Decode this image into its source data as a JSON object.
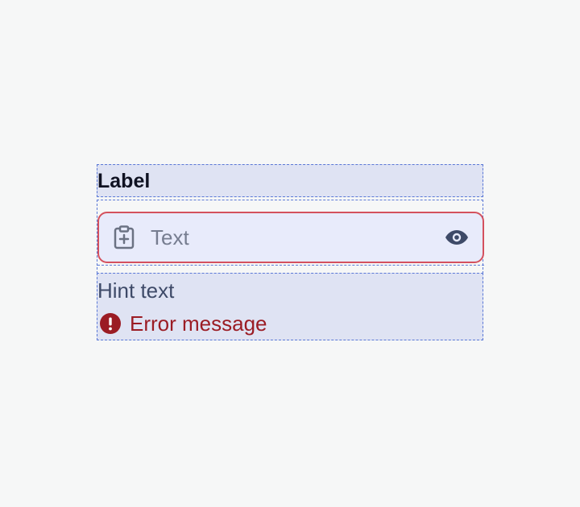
{
  "field": {
    "label": "Label",
    "input": {
      "value": "Text",
      "leading_icon": "clipboard-plus-icon",
      "trailing_icon": "eye-icon"
    },
    "hint": "Hint text",
    "error": {
      "icon": "error-circle-icon",
      "message": "Error message"
    }
  },
  "colors": {
    "background": "#f6f7f7",
    "container_fill": "#dfe3f3",
    "guide_border": "#5a78d6",
    "input_fill": "#e8ebfb",
    "input_border_error": "#d4515e",
    "label": "#0f1222",
    "placeholder": "#767d90",
    "hint": "#3e4a68",
    "error": "#9b1c24",
    "icon": "#3e4a68"
  }
}
